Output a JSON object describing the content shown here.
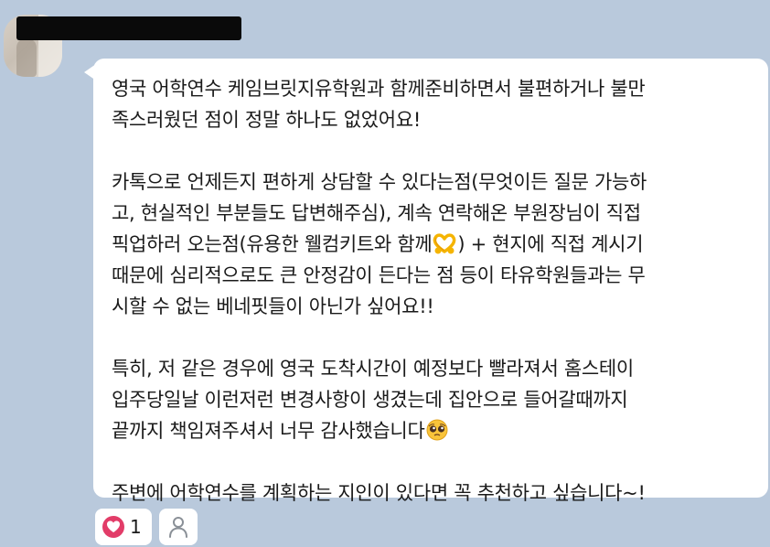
{
  "message": {
    "paragraphs": [
      "영국 어학연수 케임브릿지유학원과 함께준비하면서 불편하거나 불만\n족스러웠던 점이 정말 하나도 없었어요!",
      "카톡으로 언제든지 편하게 상담할 수 있다는점(무엇이든 질문 가능하\n고, 현실적인 부분들도 답변해주심), 계속 연락해온 부원장님이 직접\n픽업하러 오는점(유용한 웰컴키트와 함께",
      ") + 현지에 직접 계시기\n때문에 심리적으로도 큰 안정감이 든다는 점 등이 타유학원들과는 무\n시할 수 없는 베네핏들이 아닌가 싶어요!!",
      "특히, 저 같은 경우에 영국 도착시간이 예정보다 빨라져서 홈스테이\n입주당일날 이런저런 변경사항이 생겼는데 집안으로 들어갈때까지\n끝까지 책임져주셔서 너무 감사했습니다",
      "주변에 어학연수를 계획하는 지인이 있다면 꼭 추천하고 싶습니다~!"
    ],
    "emojis": [
      "heart-hands-emoji",
      "pleading-face-emoji"
    ]
  },
  "reactions": {
    "like_count": "1",
    "like_color": "#e23c68"
  },
  "colors": {
    "background": "#b9c9dc",
    "bubble": "#ffffff",
    "text": "#1a1a1a"
  }
}
